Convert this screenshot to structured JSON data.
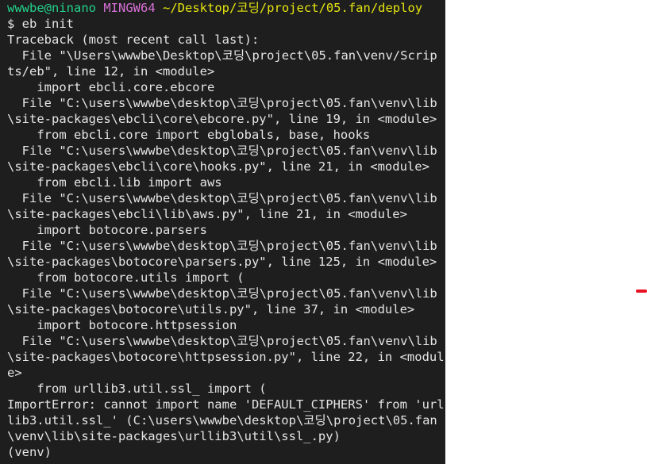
{
  "prompt": {
    "user": "wwwbe@ninano",
    "system": "MINGW64",
    "path": "~/Desktop/코딩/project/05.fan/deploy"
  },
  "lines": [
    "$ eb init",
    "Traceback (most recent call last):",
    "  File \"\\Users\\wwwbe\\Desktop\\코딩\\project\\05.fan\\venv/Scrip",
    "ts/eb\", line 12, in <module>",
    "    import ebcli.core.ebcore",
    "  File \"C:\\users\\wwwbe\\desktop\\코딩\\project\\05.fan\\venv\\lib",
    "\\site-packages\\ebcli\\core\\ebcore.py\", line 19, in <module>",
    "    from ebcli.core import ebglobals, base, hooks",
    "  File \"C:\\users\\wwwbe\\desktop\\코딩\\project\\05.fan\\venv\\lib",
    "\\site-packages\\ebcli\\core\\hooks.py\", line 21, in <module>",
    "    from ebcli.lib import aws",
    "  File \"C:\\users\\wwwbe\\desktop\\코딩\\project\\05.fan\\venv\\lib",
    "\\site-packages\\ebcli\\lib\\aws.py\", line 21, in <module>",
    "    import botocore.parsers",
    "  File \"C:\\users\\wwwbe\\desktop\\코딩\\project\\05.fan\\venv\\lib",
    "\\site-packages\\botocore\\parsers.py\", line 125, in <module>",
    "    from botocore.utils import (",
    "  File \"C:\\users\\wwwbe\\desktop\\코딩\\project\\05.fan\\venv\\lib",
    "\\site-packages\\botocore\\utils.py\", line 37, in <module>",
    "    import botocore.httpsession",
    "  File \"C:\\users\\wwwbe\\desktop\\코딩\\project\\05.fan\\venv\\lib",
    "\\site-packages\\botocore\\httpsession.py\", line 22, in <modul",
    "e>",
    "    from urllib3.util.ssl_ import (",
    "ImportError: cannot import name 'DEFAULT_CIPHERS' from 'url",
    "lib3.util.ssl_' (C:\\users\\wwwbe\\desktop\\코딩\\project\\05.fan",
    "\\venv\\lib\\site-packages\\urllib3\\util\\ssl_.py)",
    "(venv)"
  ],
  "colors": {
    "background": "#1e1e1e",
    "text": "#e5e5e5",
    "user": "#23d18b",
    "system": "#d670d6",
    "path": "#e5e510",
    "mark": "#e81123"
  }
}
